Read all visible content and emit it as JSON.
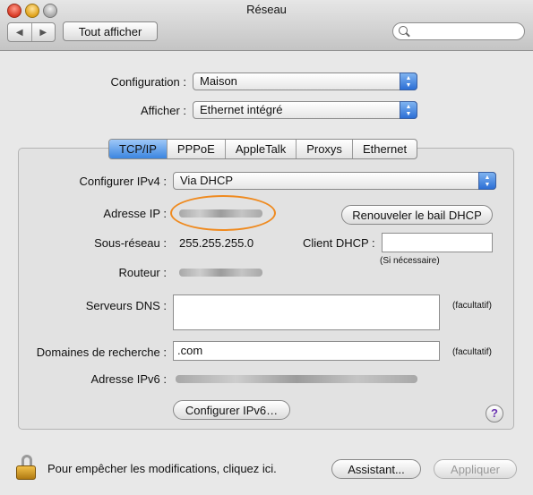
{
  "window": {
    "title": "Réseau"
  },
  "toolbar": {
    "back_glyph": "◀",
    "forward_glyph": "▶",
    "show_all_label": "Tout afficher",
    "search_placeholder": ""
  },
  "top": {
    "configuration_label": "Configuration :",
    "configuration_value": "Maison",
    "afficher_label": "Afficher :",
    "afficher_value": "Ethernet intégré"
  },
  "tabs": [
    "TCP/IP",
    "PPPoE",
    "AppleTalk",
    "Proxys",
    "Ethernet"
  ],
  "active_tab": "TCP/IP",
  "tcpip": {
    "configurer_ipv4_label": "Configurer IPv4 :",
    "configurer_ipv4_value": "Via DHCP",
    "adresse_ip_label": "Adresse IP :",
    "renew_button": "Renouveler le bail DHCP",
    "sous_reseau_label": "Sous-réseau :",
    "sous_reseau_value": "255.255.255.0",
    "client_dhcp_label": "Client DHCP :",
    "client_dhcp_value": "",
    "client_dhcp_hint": "(Si nécessaire)",
    "routeur_label": "Routeur :",
    "serveurs_dns_label": "Serveurs DNS :",
    "serveurs_dns_value": "",
    "facultatif_dns": "(facultatif)",
    "domaines_label": "Domaines de recherche :",
    "domaines_value": ".com",
    "facultatif_domaines": "(facultatif)",
    "adresse_ipv6_label": "Adresse IPv6 :",
    "configurer_ipv6_button": "Configurer IPv6…"
  },
  "help_glyph": "?",
  "footer": {
    "lock_text": "Pour empêcher les modifications, cliquez ici.",
    "assistant_button": "Assistant...",
    "appliquer_button": "Appliquer"
  },
  "colors": {
    "tab_active": "#3b85e0",
    "highlight_ellipse": "#ef8a1f",
    "help_glyph": "#6a32b0"
  }
}
